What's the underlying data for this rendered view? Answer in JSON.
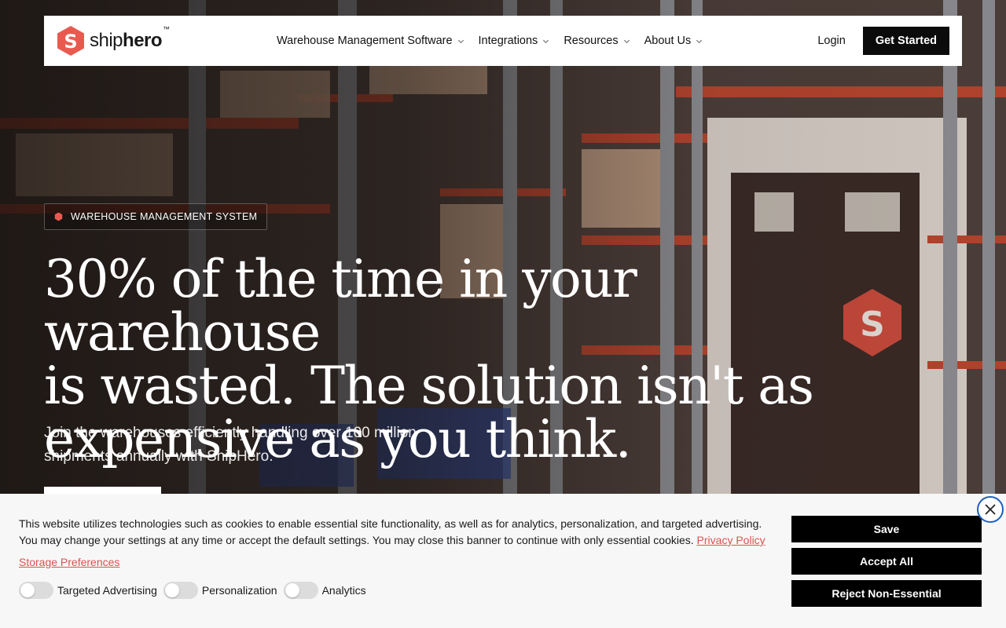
{
  "nav": {
    "logo_text_light": "ship",
    "logo_text_bold": "hero",
    "logo_tm": "™",
    "menu": [
      {
        "label": "Warehouse Management Software"
      },
      {
        "label": "Integrations"
      },
      {
        "label": "Resources"
      },
      {
        "label": "About Us"
      }
    ],
    "login_label": "Login",
    "cta_label": "Get Started"
  },
  "hero": {
    "badge": "WAREHOUSE MANAGEMENT SYSTEM",
    "headline_line1": "30% of the time in your warehouse",
    "headline_line2": "is wasted. The solution isn't as",
    "headline_line3": "expensive as you think.",
    "subhead": "Join the warehouses efficiently handling over 100 million shipments annually with ShipHero."
  },
  "cookie": {
    "text": "This website utilizes technologies such as cookies to enable essential site functionality, as well as for analytics, personalization, and targeted advertising. You may change your settings at any time or accept the default settings. You may close this banner to continue with only essential cookies.",
    "privacy_link": "Privacy Policy",
    "storage_link": "Storage Preferences",
    "toggles": [
      {
        "label": "Targeted Advertising"
      },
      {
        "label": "Personalization"
      },
      {
        "label": "Analytics"
      }
    ],
    "save_label": "Save",
    "accept_label": "Accept All",
    "reject_label": "Reject Non-Essential"
  },
  "colors": {
    "brand_red": "#e85a4f",
    "link_red": "#d9534f",
    "focus_blue": "#1f5fbf"
  }
}
